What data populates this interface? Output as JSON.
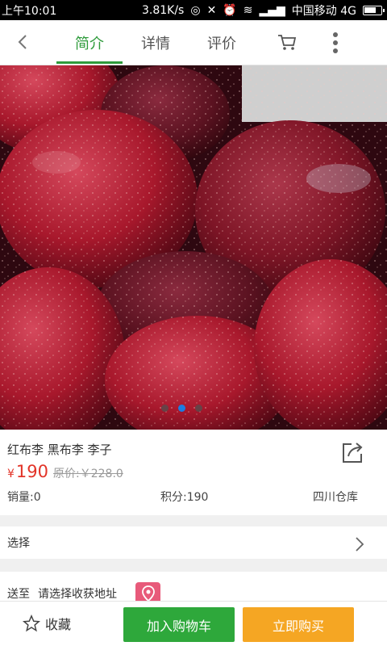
{
  "status_bar": {
    "time": "上午10:01",
    "network_speed": "3.81K/s",
    "carrier": "中国移动 4G"
  },
  "nav": {
    "tabs": [
      {
        "label": "简介",
        "active": true
      },
      {
        "label": "详情",
        "active": false
      },
      {
        "label": "评价",
        "active": false
      }
    ],
    "accent_color": "#2e9b3b",
    "icons": {
      "back": "back-arrow-icon",
      "cart": "cart-icon",
      "more": "more-vertical-icon"
    }
  },
  "product_image": {
    "slide_count": 3,
    "active_slide": 2
  },
  "product": {
    "title": "红布李 黑布李 李子",
    "currency": "¥",
    "price": "190",
    "original_price": "原价:￥228.0",
    "sales": "销量:0",
    "points": "积分:190",
    "warehouse": "四川仓库",
    "price_color": "#e23428"
  },
  "select": {
    "label": "选择"
  },
  "shipping": {
    "label": "送至",
    "value": "请选择收获地址"
  },
  "bottom_bar": {
    "favorite_label": "收藏",
    "add_to_cart_label": "加入购物车",
    "buy_now_label": "立即购买",
    "add_to_cart_color": "#2ea83b",
    "buy_now_color": "#f5a623"
  }
}
